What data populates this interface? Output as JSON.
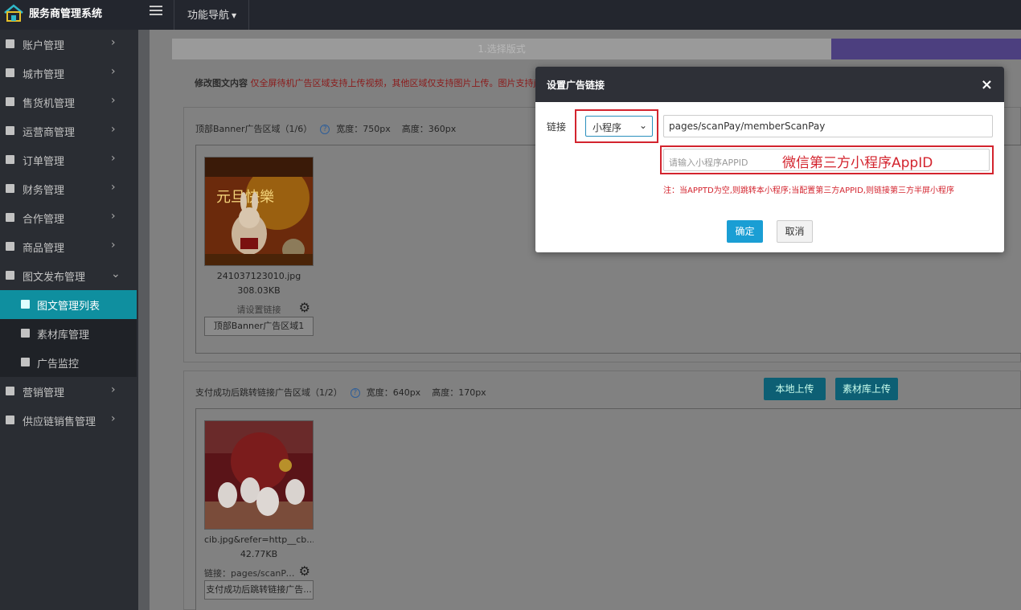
{
  "app": {
    "brand": "服务商管理系统",
    "func_nav": "功能导航"
  },
  "sidebar": {
    "items": [
      {
        "label": "账户管理"
      },
      {
        "label": "城市管理"
      },
      {
        "label": "售货机管理"
      },
      {
        "label": "运营商管理"
      },
      {
        "label": "订单管理"
      },
      {
        "label": "财务管理"
      },
      {
        "label": "合作管理"
      },
      {
        "label": "商品管理"
      },
      {
        "label": "图文发布管理"
      },
      {
        "label": "图文管理列表"
      },
      {
        "label": "素材库管理"
      },
      {
        "label": "广告监控"
      },
      {
        "label": "营销管理"
      },
      {
        "label": "供应链销售管理"
      }
    ]
  },
  "steps": {
    "step1": "1.选择版式"
  },
  "hint": {
    "bold": "修改图文内容",
    "red": "仅全屏待机广告区域支持上传视频，其他区域仅支持图片上传。图片支持jp"
  },
  "banner_section": {
    "title": "顶部Banner广告区域（1/6）",
    "help": "?",
    "width": "宽度：750px",
    "height": "高度：360px",
    "card": {
      "filename": "241037123010.jpg",
      "size": "308.03KB",
      "link_text": "请设置链接",
      "area_label": "顶部Banner广告区域1",
      "image_text": "元旦快樂"
    }
  },
  "pay_section": {
    "title": "支付成功后跳转链接广告区域（1/2）",
    "help": "?",
    "width": "宽度：640px",
    "height": "高度：170px",
    "local_upload": "本地上传",
    "library_upload": "素材库上传",
    "card": {
      "filename": "cib.jpg&refer=http__cb...",
      "size": "42.77KB",
      "link_text": "链接：pages/scanPa...",
      "area_label": "支付成功后跳转链接广告..."
    }
  },
  "modal": {
    "title": "设置广告链接",
    "close": "×",
    "link_label": "链接",
    "select_value": "小程序",
    "path_value": "pages/scanPay/memberScanPay",
    "appid_placeholder": "请输入小程序APPID",
    "annotation": "微信第三方小程序AppID",
    "note": "注：当APPTD为空,则跳转本小程序;当配置第三方APPID,则链接第三方半屏小程序",
    "ok": "确定",
    "cancel": "取消"
  },
  "colors": {
    "accent": "#1a9ed4",
    "sidebar_active": "#0f8f9f",
    "annotation_red": "#d3242e",
    "topbar": "#23262e"
  },
  "icons": [
    "home-logo-icon",
    "menu-toggle-icon",
    "caret-down-icon",
    "chevron-right-icon",
    "chevron-down-icon",
    "help-circle-icon",
    "gear-icon",
    "close-icon"
  ]
}
